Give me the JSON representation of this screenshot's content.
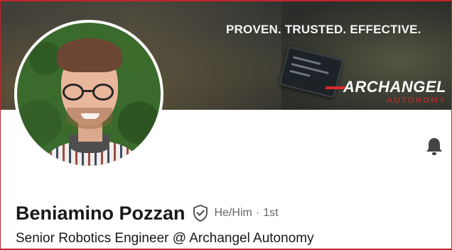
{
  "banner": {
    "tagline": "PROVEN. TRUSTED. EFFECTIVE.",
    "brand_name": "ARCHANGEL",
    "brand_sub": "AUTONOMY",
    "brand_accent_color": "#d8282f"
  },
  "profile": {
    "name": "Beniamino Pozzan",
    "pronouns": "He/Him",
    "separator": "·",
    "connection_degree": "1st",
    "headline": "Senior Robotics Engineer @ Archangel Autonomy",
    "verified_icon": "shield-check-icon",
    "notification_icon": "bell-icon"
  },
  "colors": {
    "text_primary": "#191919",
    "text_secondary": "#666666",
    "frame_accent": "#c0262d"
  }
}
